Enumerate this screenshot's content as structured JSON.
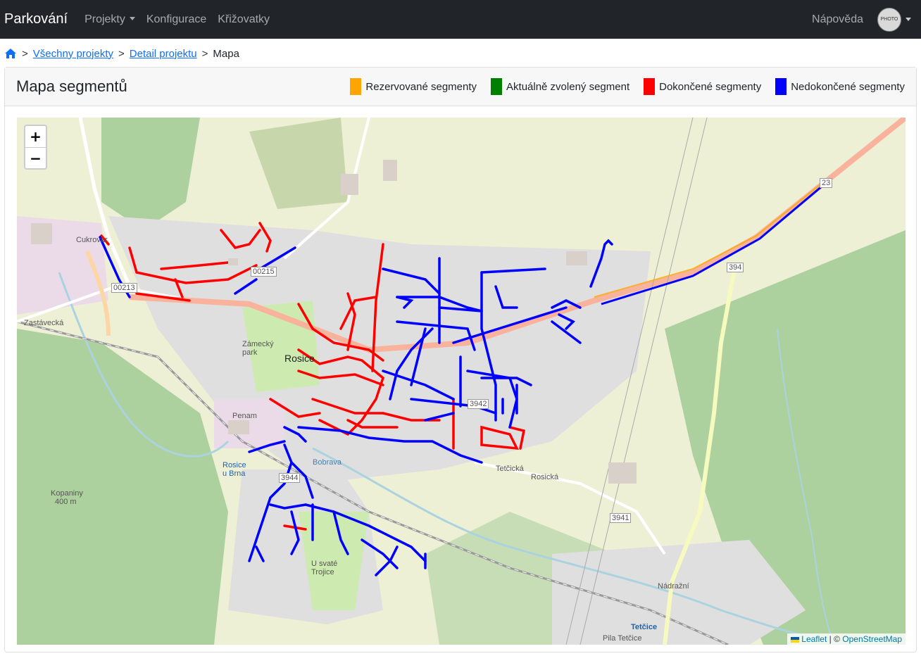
{
  "navbar": {
    "brand": "Parkování",
    "items": [
      {
        "label": "Projekty",
        "dropdown": true
      },
      {
        "label": "Konfigurace"
      },
      {
        "label": "Křižovatky"
      }
    ],
    "help": "Nápověda",
    "avatar_text": "PHOTO"
  },
  "breadcrumb": {
    "home_icon": "home-icon",
    "items": [
      "Všechny projekty",
      "Detail projektu"
    ],
    "current": "Mapa",
    "separator": ">"
  },
  "card": {
    "title": "Mapa segmentů",
    "legend": [
      {
        "label": "Rezervované segmenty",
        "color": "#ffa500"
      },
      {
        "label": "Aktuálně zvolený segment",
        "color": "#008000"
      },
      {
        "label": "Dokončené segmenty",
        "color": "#ff0000"
      },
      {
        "label": "Nedokončené segmenty",
        "color": "#0000ff"
      }
    ]
  },
  "map": {
    "zoom_in": "+",
    "zoom_out": "−",
    "attribution": {
      "leaflet": "Leaflet",
      "separator": "| ©",
      "osm": "OpenStreetMap"
    },
    "labels": {
      "rosice": "Rosice",
      "zamecky_park": "Zámecký park",
      "penam": "Penam",
      "rosice_u_brna": "Rosice u Brna",
      "kopaniny": "Kopaniny",
      "kopaniny_alt": "400 m",
      "u_svate_trojice": "U svaté Trojice",
      "tetcice": "Tetčice",
      "pila_tetcice": "Pila Tetčice",
      "cukrovar": "Cukrovar",
      "zastavecka": "Zastávecká",
      "bobrava": "Bobrava",
      "rosicka": "Rosická",
      "tetcicka": "Tetčická",
      "nadrazni": "Nádražní",
      "road_23": "23",
      "road_394": "394",
      "road_3941": "3941",
      "road_3942": "3942",
      "road_3944": "3944",
      "road_00215": "00215",
      "road_00213": "00213"
    }
  }
}
